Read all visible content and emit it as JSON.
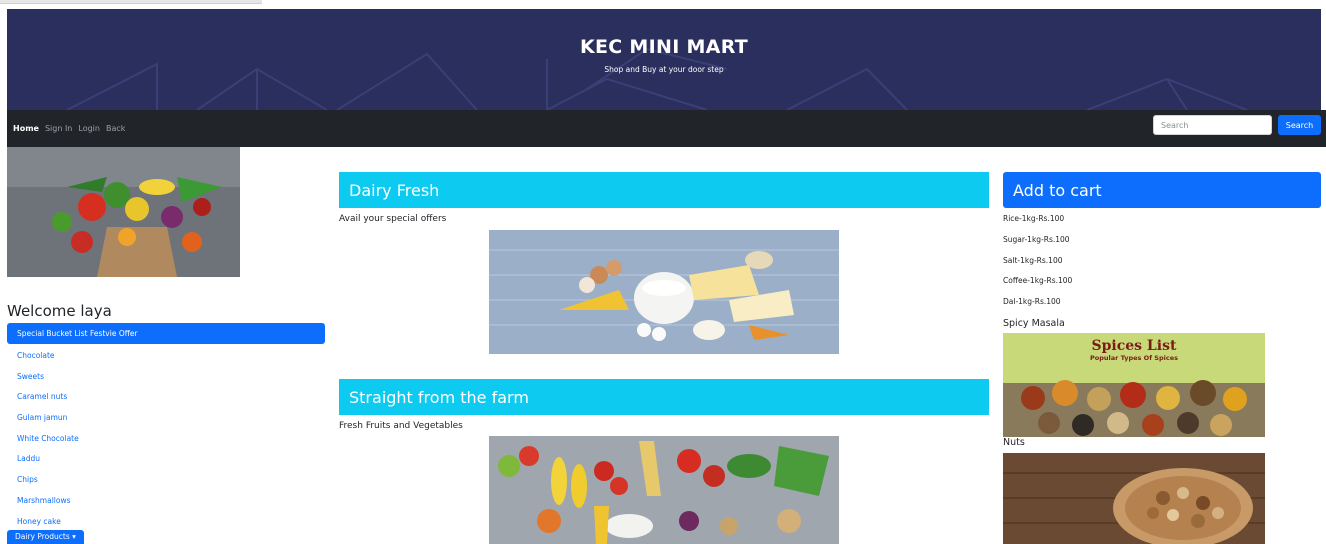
{
  "header": {
    "title": "KEC MINI MART",
    "subtitle": "Shop and Buy at your door step"
  },
  "nav": {
    "links": [
      "Home",
      "Sign In",
      "Login",
      "Back"
    ],
    "search_placeholder": "Search",
    "search_button": "Search"
  },
  "sidebar": {
    "welcome": "Welcome laya",
    "active_item": "Special Bucket List Festvie Offer",
    "items": [
      "Chocolate",
      "Sweets",
      "Caramel nuts",
      "Gulam jamun",
      "White Chocolate",
      "Laddu",
      "Chips",
      "Marshmallows",
      "Honey cake"
    ],
    "dropdown": "Dairy Products"
  },
  "main": {
    "sections": [
      {
        "title": "Dairy Fresh",
        "subtitle": "Avail your special offers"
      },
      {
        "title": "Straight from the farm",
        "subtitle": "Fresh Fruits and Vegetables"
      }
    ]
  },
  "cart": {
    "title": "Add to cart",
    "items": [
      "Rice-1kg-Rs.100",
      "Sugar-1kg-Rs.100",
      "Salt-1kg-Rs.100",
      "Coffee-1kg-Rs.100",
      "Dal-1kg-Rs.100"
    ],
    "spicy_label": "Spicy Masala",
    "spices_title": "Spices List",
    "spices_subtitle": "Popular Types Of Spices",
    "nuts_label": "Nuts"
  },
  "colors": {
    "hero_bg": "#2b2f5e",
    "navbar_bg": "#212529",
    "primary": "#0d6efd",
    "info": "#0dcaf0"
  },
  "icons": {
    "dropdown": "caret-down-icon"
  }
}
